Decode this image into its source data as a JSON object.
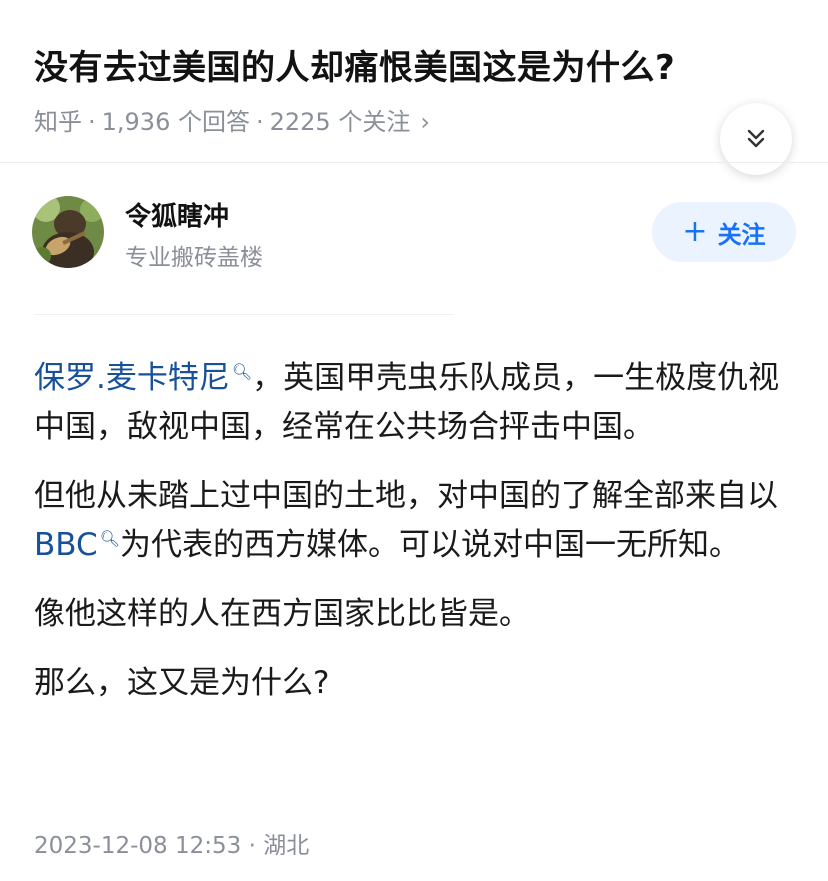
{
  "question": {
    "title": "没有去过美国的人却痛恨美国这是为什么?",
    "source": "知乎",
    "answers_count": "1,936 个回答",
    "followers_count": "2225 个关注",
    "meta_separator": "·"
  },
  "author": {
    "name": "令狐瞎冲",
    "bio": "专业搬砖盖楼",
    "follow_plus": "+",
    "follow_label": "关注"
  },
  "answer": {
    "p1_link": "保罗.麦卡特尼",
    "p1_rest": "，英国甲壳虫乐队成员，一生极度仇视中国，敌视中国，经常在公共场合抨击中国。",
    "p2_before": "但他从未踏上过中国的土地，对中国的了解全部来自以",
    "p2_link": "BBC",
    "p2_after": "为代表的西方媒体。可以说对中国一无所知。",
    "p3": "像他这样的人在西方国家比比皆是。",
    "p4": "那么，这又是为什么?"
  },
  "footer": {
    "datetime": "2023-12-08 12:53",
    "separator": "·",
    "location": "湖北"
  },
  "icons": {
    "collapse": "double-chevron-down-icon",
    "link_search": "search-mini-icon",
    "meta_arrow": "chevron-right-icon"
  },
  "colors": {
    "link": "#175199",
    "follow_text": "#1772f6",
    "follow_bg": "#ebf3ff",
    "meta_gray": "#8a8f99"
  }
}
